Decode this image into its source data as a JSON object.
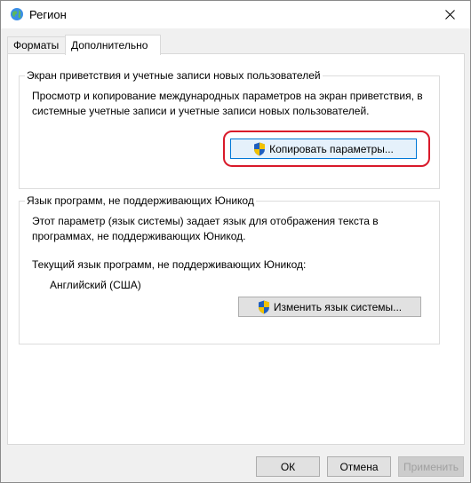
{
  "window": {
    "title": "Регион",
    "close_symbol": "✕"
  },
  "tabs": [
    {
      "label": "Форматы",
      "active": false
    },
    {
      "label": "Дополнительно",
      "active": true
    }
  ],
  "welcome_group": {
    "legend": "Экран приветствия и учетные записи новых пользователей",
    "line1": "Просмотр и копирование международных параметров на экран приветствия, в",
    "line2": "системные учетные записи и учетные записи новых пользователей.",
    "button_label": "Копировать параметры..."
  },
  "unicode_group": {
    "legend": "Язык программ, не поддерживающих Юникод",
    "line1": "Этот параметр (язык системы) задает язык для отображения текста в",
    "line2": "программах, не поддерживающих Юникод.",
    "current_label": "Текущий язык программ, не поддерживающих Юникод:",
    "current_value": "Английский (США)",
    "button_label": "Изменить язык системы..."
  },
  "footer": {
    "ok_label": "ОК",
    "cancel_label": "Отмена",
    "apply_label": "Применить"
  },
  "colors": {
    "highlight": "#d91a2a",
    "shield_blue": "#1f5fbf",
    "shield_yellow": "#f2c200"
  }
}
